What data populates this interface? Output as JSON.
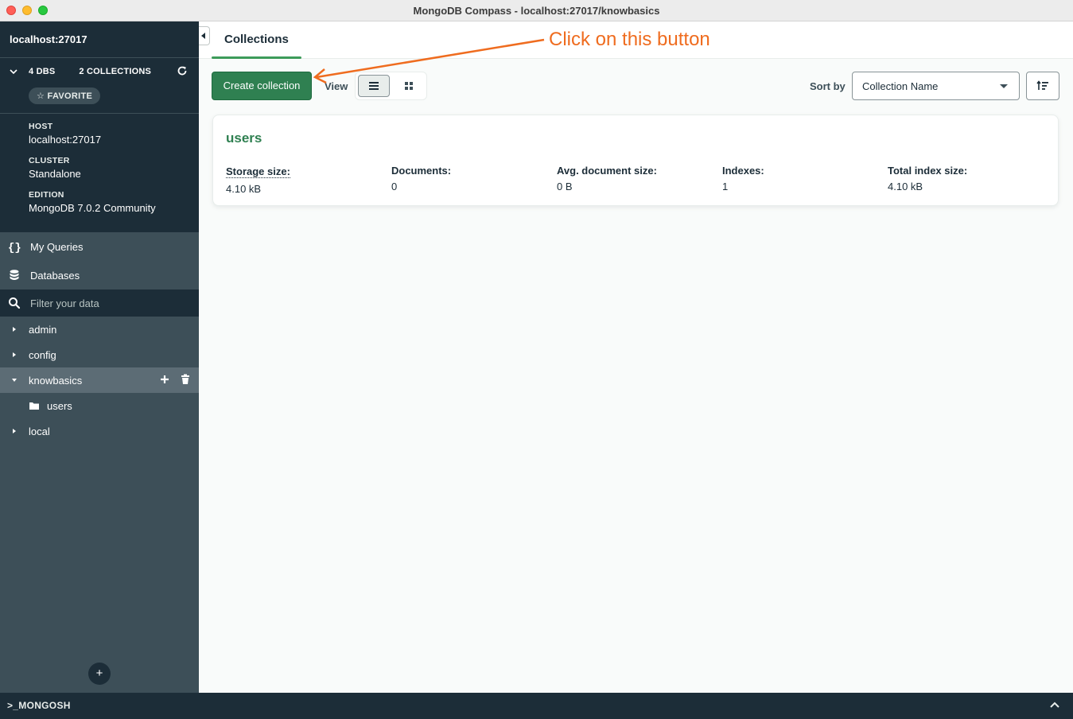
{
  "window": {
    "title": "MongoDB Compass - localhost:27017/knowbasics"
  },
  "sidebar": {
    "connection_name": "localhost:27017",
    "dbs_count": "4",
    "dbs_label": "DBS",
    "collections_count": "2",
    "collections_label": "COLLECTIONS",
    "favorite_label": "FAVORITE",
    "details": [
      {
        "label": "HOST",
        "value": "localhost:27017"
      },
      {
        "label": "CLUSTER",
        "value": "Standalone"
      },
      {
        "label": "EDITION",
        "value": "MongoDB 7.0.2 Community"
      }
    ],
    "nav": [
      {
        "label": "My Queries"
      },
      {
        "label": "Databases"
      }
    ],
    "filter_placeholder": "Filter your data",
    "databases": [
      {
        "name": "admin"
      },
      {
        "name": "config"
      },
      {
        "name": "knowbasics"
      },
      {
        "name": "local"
      }
    ],
    "expanded_collections": [
      {
        "name": "users"
      }
    ]
  },
  "main": {
    "tab_label": "Collections",
    "create_button": "Create collection",
    "view_label": "View",
    "sort_label": "Sort by",
    "sort_value": "Collection Name",
    "collection_card": {
      "name": "users",
      "metrics": [
        {
          "label": "Storage size:",
          "value": "4.10 kB"
        },
        {
          "label": "Documents:",
          "value": "0"
        },
        {
          "label": "Avg. document size:",
          "value": "0 B"
        },
        {
          "label": "Indexes:",
          "value": "1"
        },
        {
          "label": "Total index size:",
          "value": "4.10 kB"
        }
      ]
    }
  },
  "annotation": {
    "text": "Click on this button",
    "color": "#ef6c1f"
  },
  "bottom_bar": {
    "label": ">_MONGOSH"
  },
  "colors": {
    "brand_green": "#2f8051",
    "sidebar_dark": "#1c2d38",
    "sidebar": "#3d4f58"
  }
}
